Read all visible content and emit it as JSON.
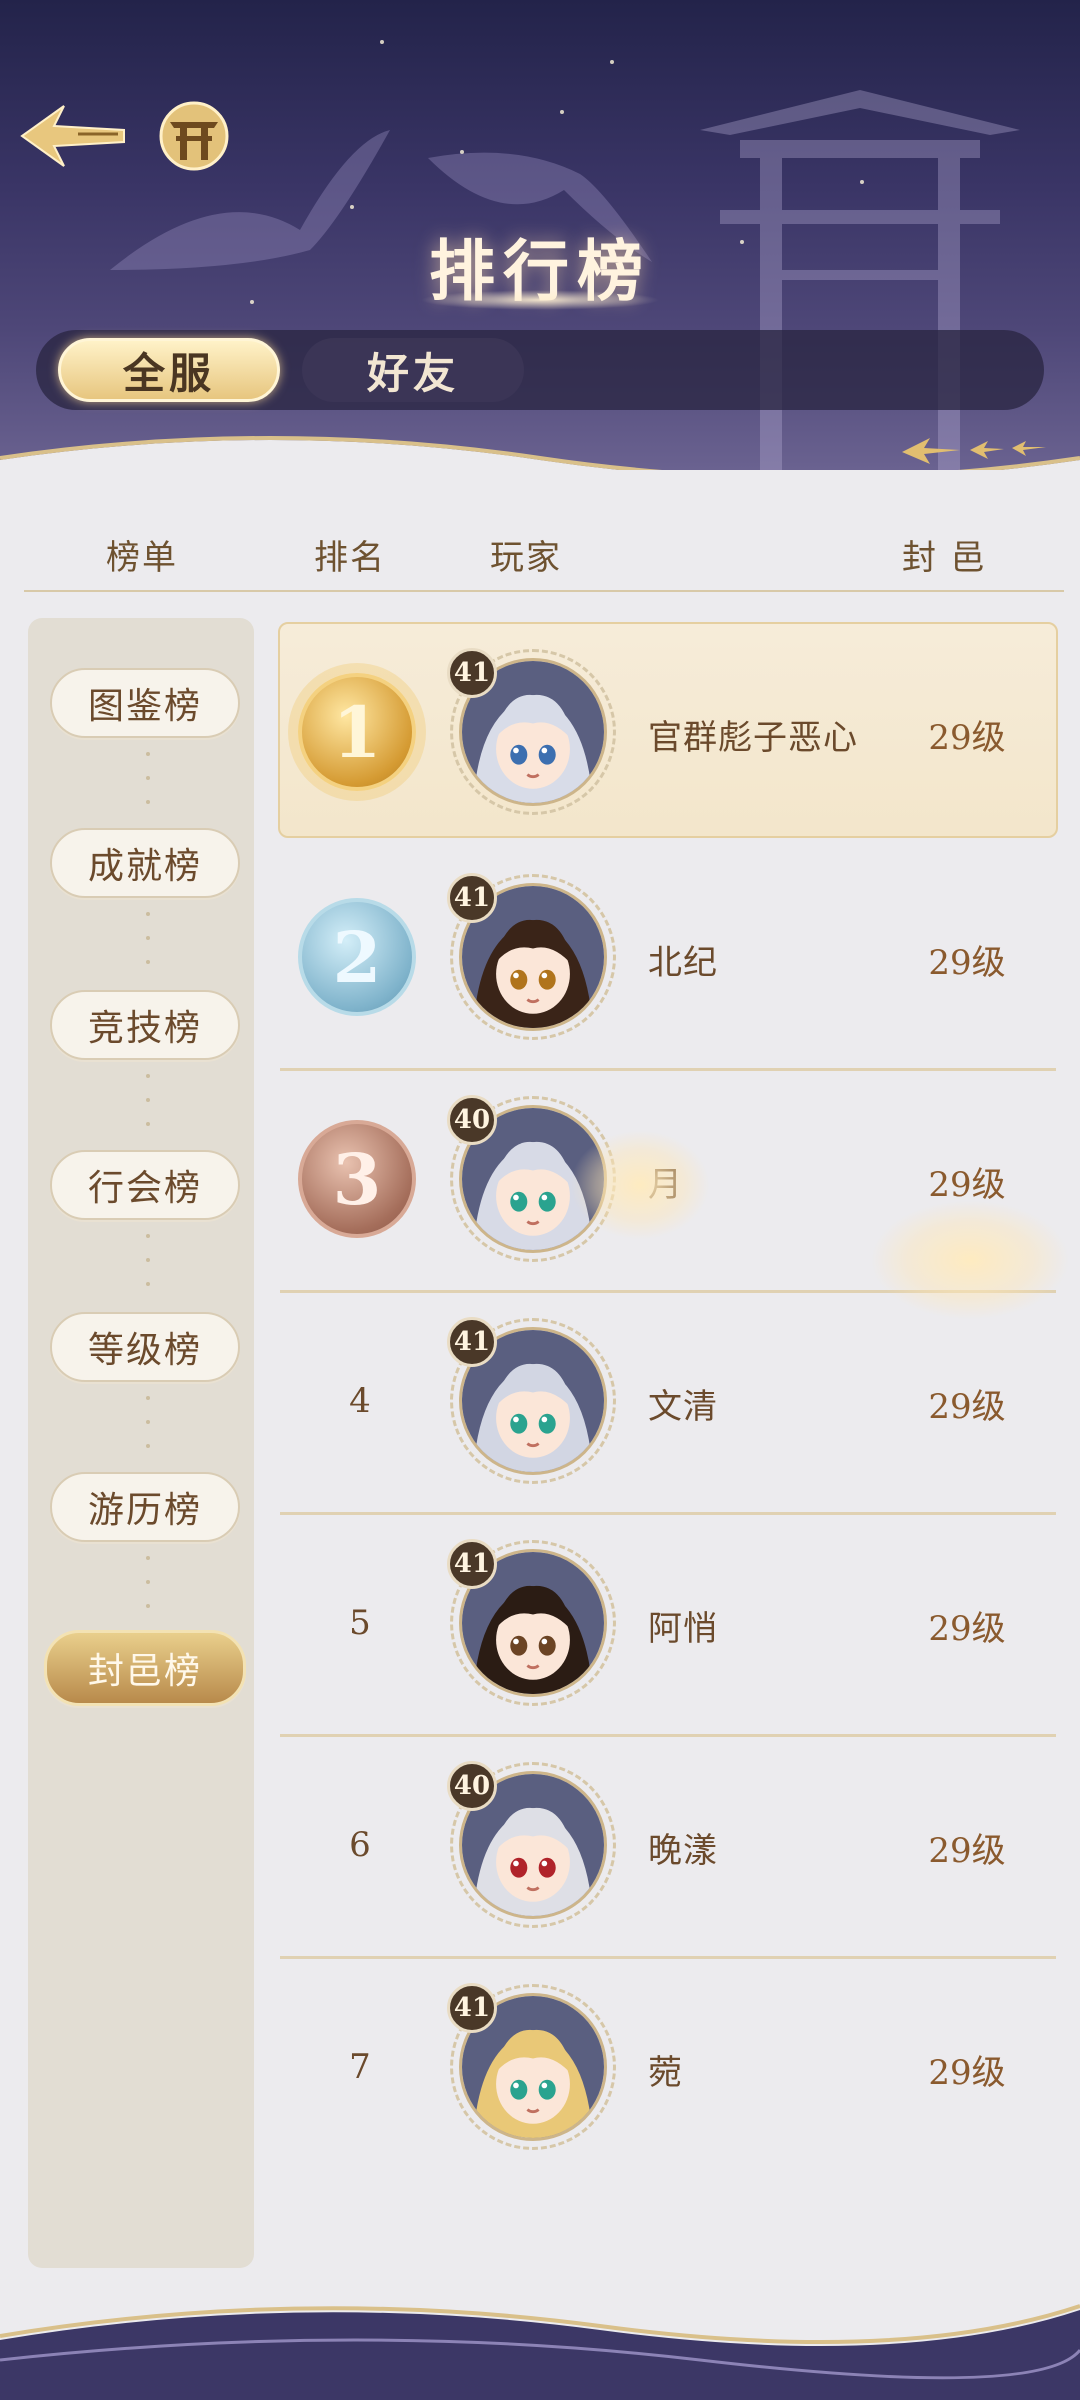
{
  "header": {
    "title": "排行榜"
  },
  "tabs": [
    {
      "label": "全服",
      "active": true
    },
    {
      "label": "好友",
      "active": false
    }
  ],
  "columns": {
    "list": "榜单",
    "rank": "排名",
    "player": "玩家",
    "fief": "封 邑"
  },
  "sidebar": {
    "items": [
      {
        "label": "图鉴榜",
        "active": false
      },
      {
        "label": "成就榜",
        "active": false
      },
      {
        "label": "竞技榜",
        "active": false
      },
      {
        "label": "行会榜",
        "active": false
      },
      {
        "label": "等级榜",
        "active": false
      },
      {
        "label": "游历榜",
        "active": false
      },
      {
        "label": "封邑榜",
        "active": true
      }
    ]
  },
  "rows": [
    {
      "rank": "1",
      "medal": "gold",
      "level": "41",
      "name": "官群彪子恶心",
      "fief": "29级",
      "hair": "#d8dce8",
      "eyes": "#3c6fb0"
    },
    {
      "rank": "2",
      "medal": "silver",
      "level": "41",
      "name": "北纪",
      "fief": "29级",
      "hair": "#3a2418",
      "eyes": "#b0741c"
    },
    {
      "rank": "3",
      "medal": "bronze",
      "level": "40",
      "name": "月",
      "fief": "29级",
      "hair": "#d7dae6",
      "eyes": "#2aa38f"
    },
    {
      "rank": "4",
      "medal": "",
      "level": "41",
      "name": "文清",
      "fief": "29级",
      "hair": "#d2d6e3",
      "eyes": "#2aa38f"
    },
    {
      "rank": "5",
      "medal": "",
      "level": "41",
      "name": "阿悄",
      "fief": "29级",
      "hair": "#2b1c14",
      "eyes": "#6b4424"
    },
    {
      "rank": "6",
      "medal": "",
      "level": "40",
      "name": "晚漾",
      "fief": "29级",
      "hair": "#dedfe6",
      "eyes": "#b0232a"
    },
    {
      "rank": "7",
      "medal": "",
      "level": "41",
      "name": "菀",
      "fief": "29级",
      "hair": "#e9c877",
      "eyes": "#2aa38f"
    }
  ],
  "colors": {
    "accent": "#b88a4b",
    "text": "#6b4a2c",
    "header_bg": "#2c2a55"
  }
}
